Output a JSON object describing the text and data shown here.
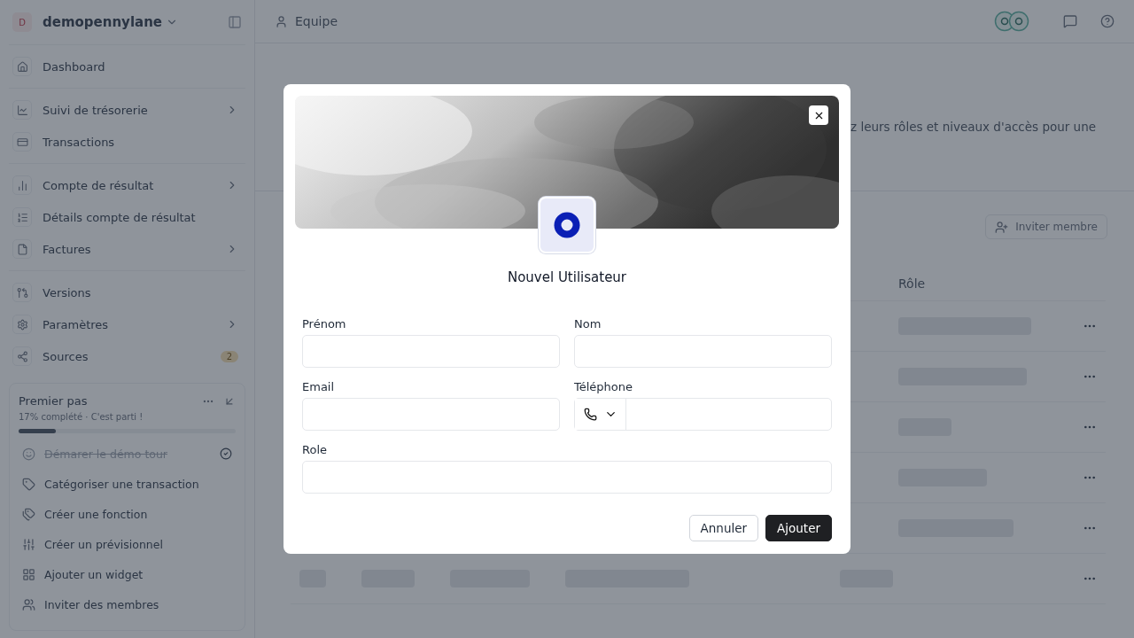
{
  "sidebar": {
    "workspace": {
      "initial": "D",
      "name": "demopennylane"
    },
    "groups": [
      {
        "items": [
          {
            "label": "Dashboard",
            "chevron": false
          }
        ]
      },
      {
        "items": [
          {
            "label": "Suivi de trésorerie",
            "chevron": true
          },
          {
            "label": "Transactions",
            "chevron": false
          }
        ]
      },
      {
        "items": [
          {
            "label": "Compte de résultat",
            "chevron": true
          },
          {
            "label": "Détails compte de résultat",
            "chevron": false
          },
          {
            "label": "Factures",
            "chevron": true
          }
        ]
      },
      {
        "items": [
          {
            "label": "Versions",
            "chevron": false
          },
          {
            "label": "Paramètres",
            "chevron": true
          },
          {
            "label": "Sources",
            "chevron": false,
            "badge": "2"
          }
        ]
      }
    ],
    "getting_started": {
      "title": "Premier pas",
      "progress": "17% complété · C'est parti !",
      "level": 0.17,
      "tasks": [
        {
          "label": "Démarer le démo tour",
          "done": true
        },
        {
          "label": "Catégoriser une transaction",
          "done": false
        },
        {
          "label": "Créer une fonction",
          "done": false
        },
        {
          "label": "Créer un prévisionnel",
          "done": false
        },
        {
          "label": "Ajouter un widget",
          "done": false
        },
        {
          "label": "Inviter des membres",
          "done": false
        }
      ]
    }
  },
  "header": {
    "breadcrumb": "Equipe"
  },
  "page": {
    "description": "z leurs rôles et niveaux d'accès pour une",
    "invite_button": "Inviter membre",
    "table": {
      "columns": [
        "Rôle"
      ],
      "rows": [
        {
          "kind": "loading"
        },
        {
          "kind": "loading"
        },
        {
          "kind": "loading"
        },
        {
          "kind": "loading"
        },
        {
          "kind": "loading"
        },
        {
          "kind": "loading"
        }
      ]
    }
  },
  "modal": {
    "title": "Nouvel Utilisateur",
    "fields": [
      {
        "label": "Prénom",
        "kind": "text"
      },
      {
        "label": "Nom",
        "kind": "text"
      },
      {
        "label": "Email",
        "kind": "text"
      },
      {
        "label": "Téléphone",
        "kind": "phone"
      },
      {
        "label": "Role",
        "kind": "text"
      }
    ],
    "buttons": [
      {
        "label": "Annuler",
        "kind": "secondary"
      },
      {
        "label": "Ajouter",
        "kind": "primary"
      }
    ]
  }
}
